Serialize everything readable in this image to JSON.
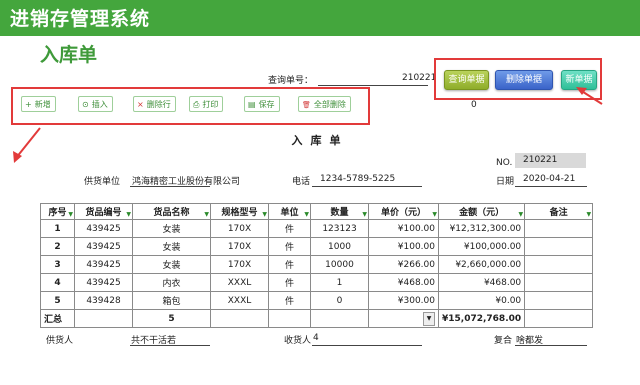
{
  "app": {
    "title": "进销存管理系统"
  },
  "page": {
    "title": "入库单"
  },
  "query": {
    "label": "查询单号：",
    "value": "210221"
  },
  "top_buttons": {
    "query": "查询单据",
    "delete": "删除单据",
    "new": "新单据"
  },
  "toolbar": [
    {
      "icon": "plus",
      "glyph": "+",
      "label": "新增"
    },
    {
      "icon": "insert",
      "glyph": "⊙",
      "label": "插入"
    },
    {
      "icon": "delete-row",
      "glyph": "×",
      "label": "删除行"
    },
    {
      "icon": "print",
      "glyph": "⎙",
      "label": "打印"
    },
    {
      "icon": "save",
      "glyph": "▤",
      "label": "保存"
    },
    {
      "icon": "trash",
      "glyph": "🗑",
      "label": "全部删除"
    }
  ],
  "page_number": "0",
  "sheet": {
    "title": "入库单",
    "no_label": "NO.",
    "no_value": "210221",
    "date_label": "日期",
    "date_value": "2020-04-21",
    "supplier_label": "供货单位",
    "supplier_value": "鸿海精密工业股份有限公司",
    "phone_label": "电话",
    "phone_value": "1234-5789-5225"
  },
  "table": {
    "headers": [
      "序号",
      "货品编号",
      "货品名称",
      "规格型号",
      "单位",
      "数量",
      "单价（元）",
      "金额（元）",
      "备注"
    ],
    "rows": [
      [
        "1",
        "439425",
        "女装",
        "170X",
        "件",
        "123123",
        "¥100.00",
        "¥12,312,300.00",
        ""
      ],
      [
        "2",
        "439425",
        "女装",
        "170X",
        "件",
        "1000",
        "¥100.00",
        "¥100,000.00",
        ""
      ],
      [
        "3",
        "439425",
        "女装",
        "170X",
        "件",
        "10000",
        "¥266.00",
        "¥2,660,000.00",
        ""
      ],
      [
        "4",
        "439425",
        "内衣",
        "XXXL",
        "件",
        "1",
        "¥468.00",
        "¥468.00",
        ""
      ],
      [
        "5",
        "439428",
        "箱包",
        "XXXL",
        "件",
        "0",
        "¥300.00",
        "¥0.00",
        ""
      ]
    ],
    "total_label": "汇总",
    "total_count": "5",
    "total_amount": "¥15,072,768.00"
  },
  "footer": {
    "supplier_person_label": "供货人",
    "supplier_person_value": "共不干活若",
    "receiver_label": "收货人",
    "receiver_value": "4",
    "review_label": "复合",
    "review_value": "啥都发"
  },
  "colors": {
    "header_green": "#44a63d",
    "title_green": "#3f9a3a",
    "highlight_red": "#e23a3a"
  }
}
